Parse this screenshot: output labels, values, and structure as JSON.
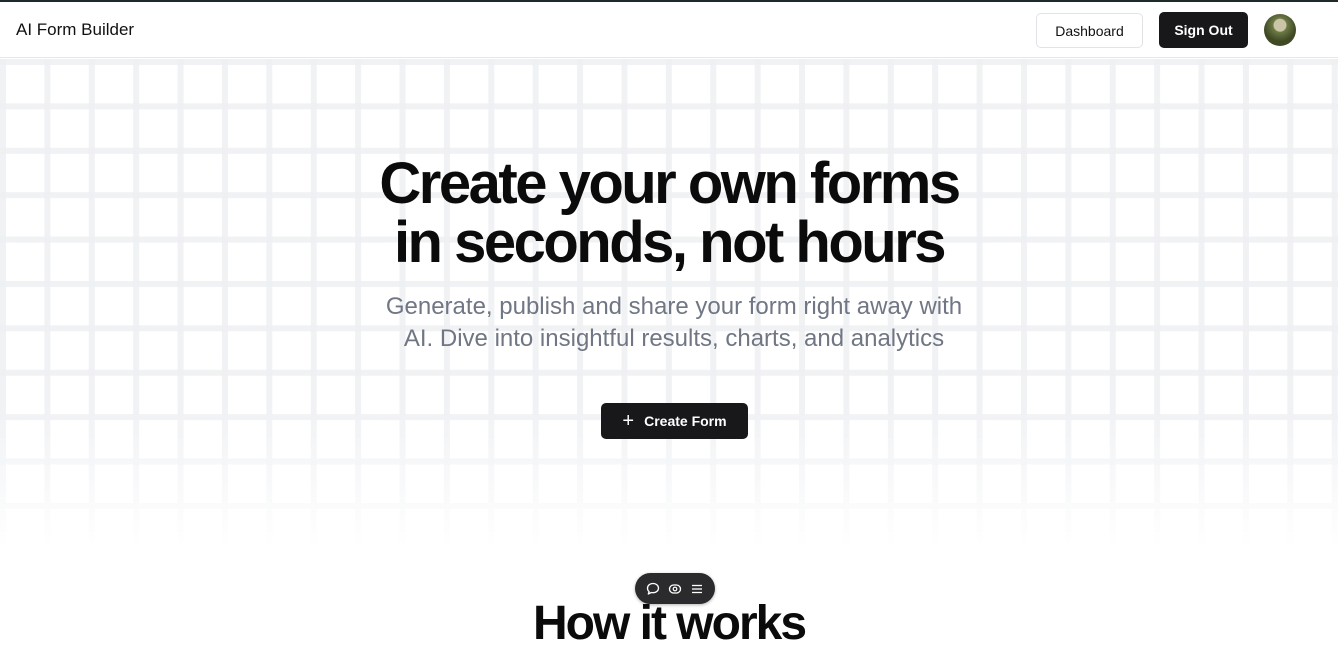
{
  "header": {
    "brand": "AI Form Builder",
    "dashboard_label": "Dashboard",
    "signout_label": "Sign Out",
    "avatar_icon": "user-avatar"
  },
  "hero": {
    "title_line1": "Create your own forms",
    "title_line2": "in seconds, not hours",
    "subtitle": "Generate, publish and share your form right away with AI. Dive into insightful results, charts, and analytics",
    "create_button_label": "Create Form",
    "create_button_icon": "plus-icon"
  },
  "section": {
    "how_title": "How it works"
  },
  "toolbar": {
    "icons": [
      "comment-icon",
      "eye-icon",
      "menu-icon"
    ]
  },
  "colors": {
    "primary_button": "#18181b",
    "subtitle_text": "#707684",
    "grid_cell": "#eef0f3"
  }
}
